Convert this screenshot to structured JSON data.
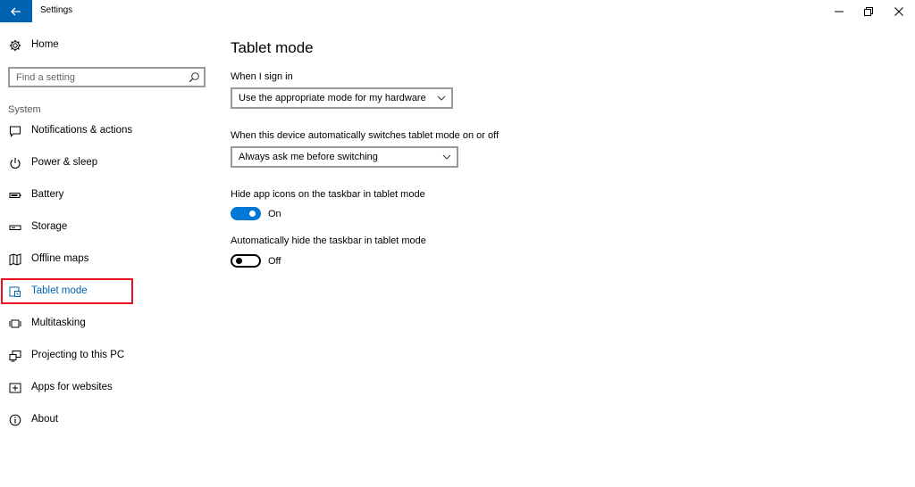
{
  "window": {
    "title": "Settings",
    "controls": [
      "minimize-icon",
      "restore-icon",
      "close-icon"
    ]
  },
  "sidebar": {
    "home_label": "Home",
    "search": {
      "placeholder": "Find a setting",
      "value": ""
    },
    "group_label": "System",
    "items": [
      {
        "label": "Notifications & actions",
        "icon": "notification-icon",
        "active": false
      },
      {
        "label": "Power & sleep",
        "icon": "power-icon",
        "active": false
      },
      {
        "label": "Battery",
        "icon": "battery-icon",
        "active": false
      },
      {
        "label": "Storage",
        "icon": "storage-icon",
        "active": false
      },
      {
        "label": "Offline maps",
        "icon": "map-icon",
        "active": false
      },
      {
        "label": "Tablet mode",
        "icon": "tablet-icon",
        "active": true
      },
      {
        "label": "Multitasking",
        "icon": "multitasking-icon",
        "active": false
      },
      {
        "label": "Projecting to this PC",
        "icon": "projecting-icon",
        "active": false
      },
      {
        "label": "Apps for websites",
        "icon": "apps-websites-icon",
        "active": false
      },
      {
        "label": "About",
        "icon": "info-icon",
        "active": false
      }
    ]
  },
  "main": {
    "title": "Tablet mode",
    "sign_in": {
      "label": "When I sign in",
      "selected": "Use the appropriate mode for my hardware"
    },
    "auto_switch": {
      "label": "When this device automatically switches tablet mode on or off",
      "selected": "Always ask me before switching"
    },
    "hide_icons": {
      "label": "Hide app icons on the taskbar in tablet mode",
      "state": "On",
      "on": true
    },
    "hide_taskbar": {
      "label": "Automatically hide the taskbar in tablet mode",
      "state": "Off",
      "on": false
    }
  },
  "colors": {
    "accent": "#0078d7",
    "title_back": "#0063b1",
    "highlight_box": "#e81123"
  }
}
